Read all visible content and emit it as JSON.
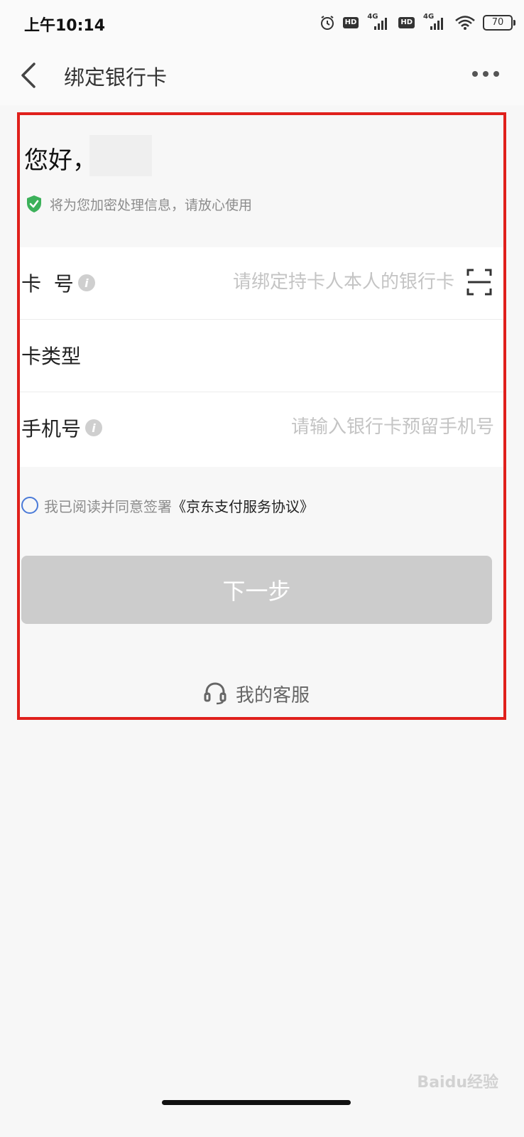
{
  "status_bar": {
    "time": "上午10:14",
    "hd_label": "HD",
    "network_label": "4G",
    "battery_level": "70"
  },
  "nav": {
    "title": "绑定银行卡"
  },
  "greeting": {
    "text": "您好，"
  },
  "secure_note": "将为您加密处理信息，请放心使用",
  "form": {
    "card_number": {
      "label": "卡  号",
      "placeholder": "请绑定持卡人本人的银行卡"
    },
    "card_type": {
      "label": "卡类型"
    },
    "phone": {
      "label": "手机号",
      "placeholder": "请输入银行卡预留手机号"
    }
  },
  "agreement": {
    "text": "我已阅读并同意签署",
    "link": "《京东支付服务协议》"
  },
  "next_button": "下一步",
  "customer_service": "我的客服",
  "watermark": "Baidu经验",
  "colors": {
    "highlight_frame": "#e0201c",
    "shield": "#3cb15a",
    "radio": "#4a7ad8",
    "button_disabled": "#cccccc"
  }
}
